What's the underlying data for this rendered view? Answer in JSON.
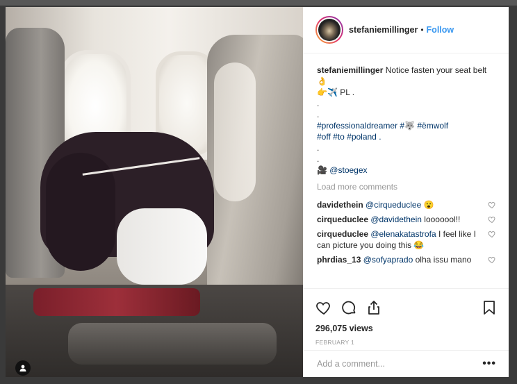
{
  "post": {
    "username": "stefaniemillinger",
    "separator": "•",
    "follow_label": "Follow",
    "caption": {
      "user": "stefaniemillinger",
      "text": " Notice fasten your seat belt",
      "emoji_line": "👌",
      "flag_line": "👉✈️ PL .",
      "dot1": ".",
      "dot2": ".",
      "tags1": "#professionaldreamer #🐺 #ëmwolf",
      "tags2": "#off #to #poland .",
      "dot3": ".",
      "dot4": ".",
      "credit_emoji": "🎥",
      "credit": "@stoegex"
    },
    "load_more": "Load more comments",
    "comments": [
      {
        "user": "davidethein",
        "mention": "@cirqueduclee",
        "text": " 😮"
      },
      {
        "user": "cirqueduclee",
        "mention": "@davidethein",
        "text": " looooool!!"
      },
      {
        "user": "cirqueduclee",
        "mention": "@elenakatastrofa",
        "text": " I feel like I can picture you doing this 😂"
      },
      {
        "user": "phrdias_13",
        "mention": "@sofyaprado",
        "text": " olha issu mano"
      }
    ],
    "views": "296,075 views",
    "date": "FEBRUARY 1",
    "add_comment_placeholder": "Add a comment...",
    "more_label": "•••"
  },
  "icons": {
    "like": "heart-icon",
    "comment": "comment-icon",
    "share": "share-icon",
    "save": "bookmark-icon",
    "user": "user-icon"
  },
  "colors": {
    "link": "#3897f0",
    "tag": "#003569",
    "text": "#262626",
    "muted": "#999999"
  }
}
